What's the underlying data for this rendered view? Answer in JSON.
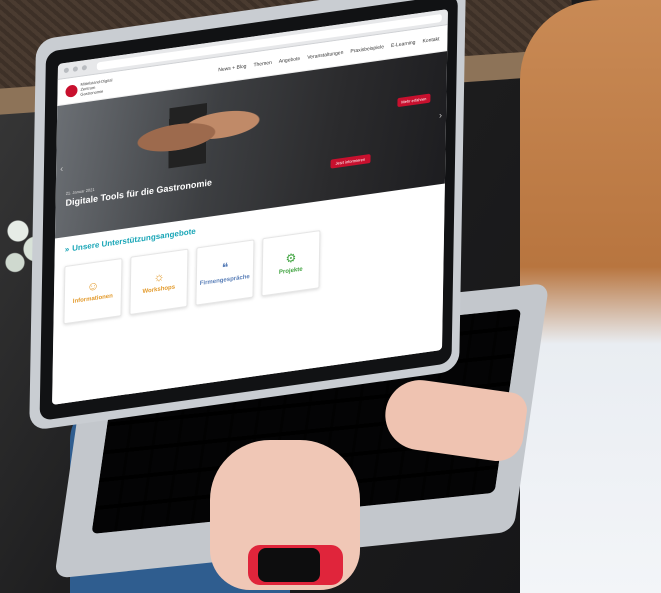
{
  "scene": {
    "colors": {
      "brand_red": "#c8102e",
      "teal": "#1aa6b7",
      "jeans": "#2f5d8f",
      "watch_band": "#e0253b"
    }
  },
  "website": {
    "nav": {
      "logo_text": "Mittelstand-Digital Zentrum Gastronomie",
      "items": [
        "News + Blog",
        "Themen",
        "Angebote",
        "Veranstaltungen",
        "Praxisbeispiele",
        "E-Learning",
        "Kontakt"
      ]
    },
    "hero": {
      "date": "21. Januar 2021",
      "title": "Digitale Tools für die Gastronomie",
      "cta": "Jetzt informieren",
      "top_button": "Mehr erfahren"
    },
    "support": {
      "title": "Unsere Unterstützungsangebote",
      "cards": [
        {
          "label": "Informationen",
          "icon": "lightbulb-user-icon",
          "color": "#e39a2b"
        },
        {
          "label": "Workshops",
          "icon": "lightbulb-icon",
          "color": "#e39a2b"
        },
        {
          "label": "Firmengespräche",
          "icon": "chat-bubbles-icon",
          "color": "#5a7fb8"
        },
        {
          "label": "Projekte",
          "icon": "gears-icon",
          "color": "#3fa33f"
        }
      ]
    }
  }
}
